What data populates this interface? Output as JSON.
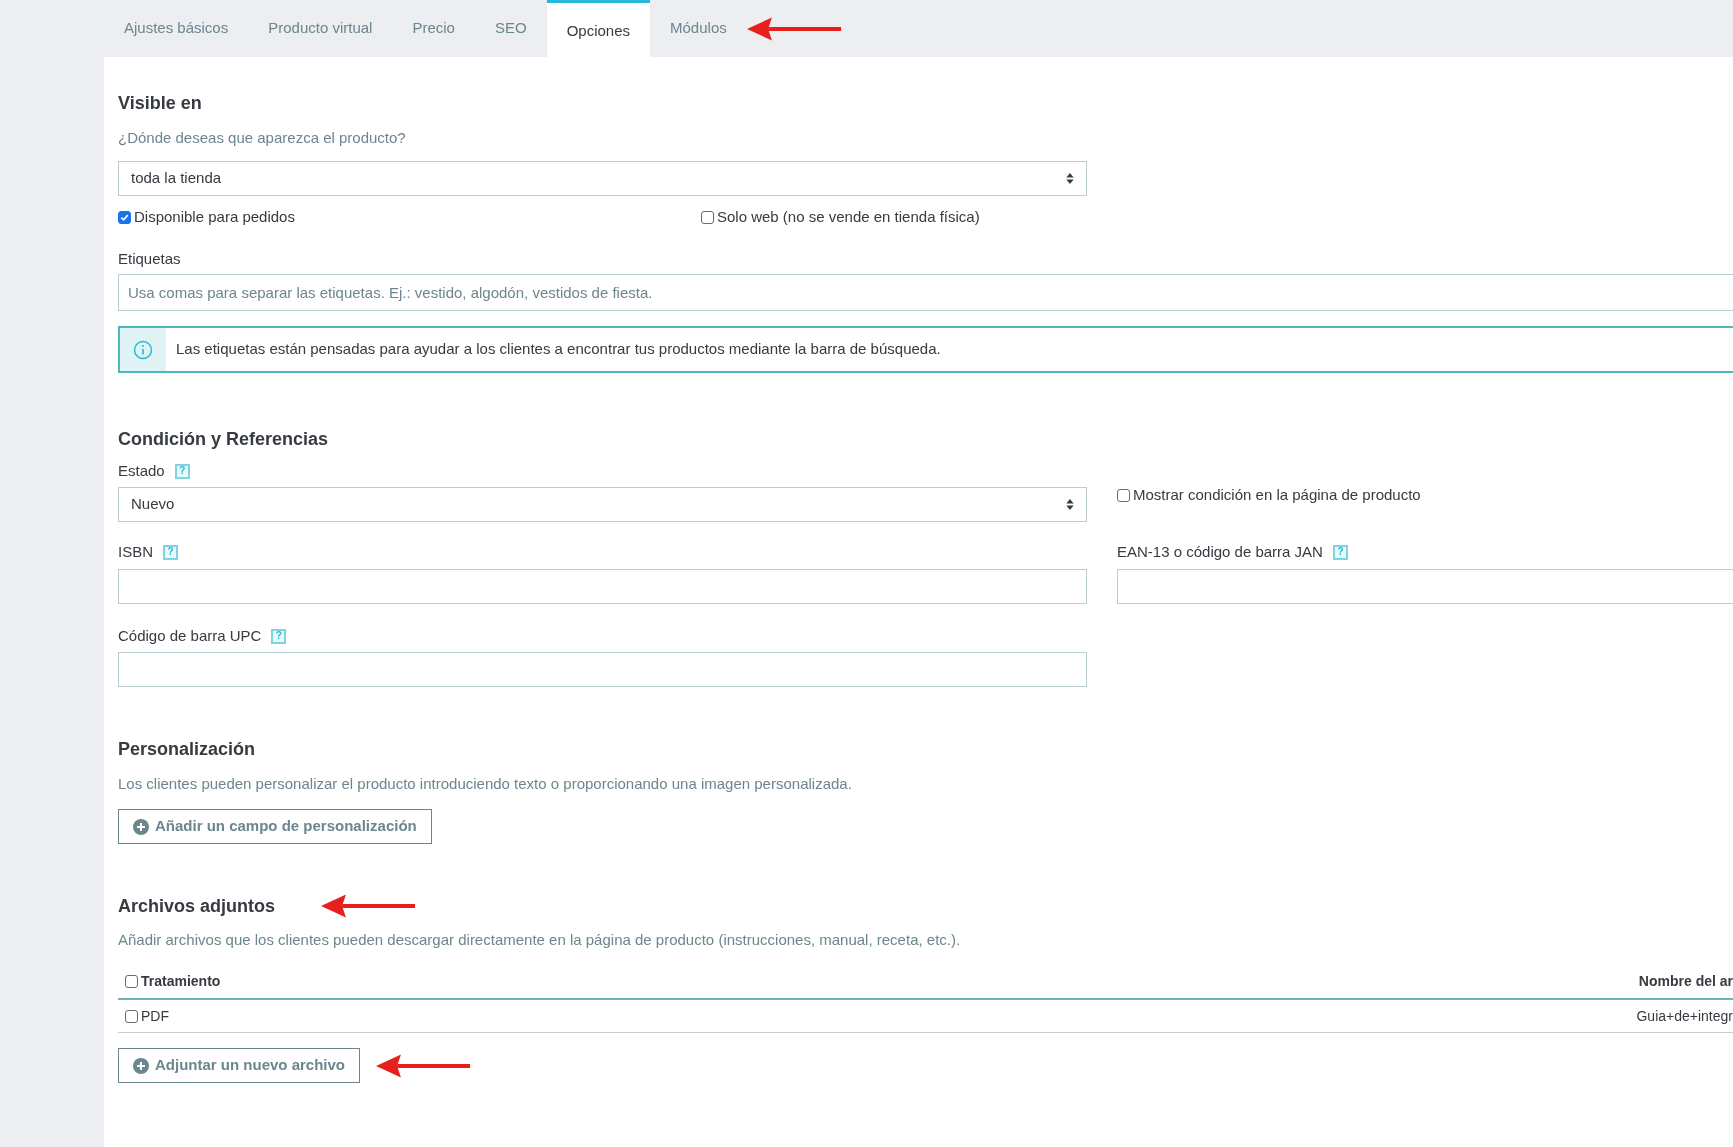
{
  "tabs": [
    {
      "label": "Ajustes básicos",
      "selected": false
    },
    {
      "label": "Producto virtual",
      "selected": false
    },
    {
      "label": "Precio",
      "selected": false
    },
    {
      "label": "SEO",
      "selected": false
    },
    {
      "label": "Opciones",
      "selected": true
    },
    {
      "label": "Módulos",
      "selected": false,
      "arrow": true
    }
  ],
  "visibility": {
    "title": "Visible en",
    "question": "¿Dónde deseas que aparezca el producto?",
    "select": {
      "value": "toda la tienda"
    },
    "checkboxes": [
      {
        "label": "Disponible para pedidos",
        "checked": true
      },
      {
        "label": "Solo web (no se vende en tienda física)",
        "checked": false
      }
    ],
    "tags": {
      "label": "Etiquetas",
      "placeholder": "Usa comas para separar las etiquetas. Ej.: vestido, algodón, vestidos de fiesta."
    },
    "info": "Las etiquetas están pensadas para ayudar a los clientes a encontrar tus productos mediante la barra de búsqueda."
  },
  "condition": {
    "title": "Condición y Referencias",
    "state": {
      "label": "Estado",
      "help": "?",
      "value": "Nuevo"
    },
    "show_condition": {
      "label": "Mostrar condición en la página de producto",
      "checked": false
    },
    "isbn": {
      "label": "ISBN",
      "help": "?"
    },
    "ean": {
      "label": "EAN-13 o código de barra JAN",
      "help": "?"
    },
    "upc": {
      "label": "Código de barra UPC",
      "help": "?"
    }
  },
  "customization": {
    "title": "Personalización",
    "description": "Los clientes pueden personalizar el producto introduciendo texto o proporcionando una imagen personalizada.",
    "button": "Añadir un campo de personalización"
  },
  "attachments": {
    "title": "Archivos adjuntos",
    "arrow": true,
    "description": "Añadir archivos que los clientes pueden descargar directamente en la página de producto (instrucciones, manual, receta, etc.).",
    "columns": [
      {
        "label": "Tratamiento",
        "checked": false
      },
      {
        "label": "Nombre del ar"
      }
    ],
    "rows": [
      {
        "checked": false,
        "cells": [
          "PDF",
          "Guia+de+integr"
        ]
      }
    ],
    "button": {
      "label": "Adjuntar un nuevo archivo",
      "arrow": true
    }
  }
}
